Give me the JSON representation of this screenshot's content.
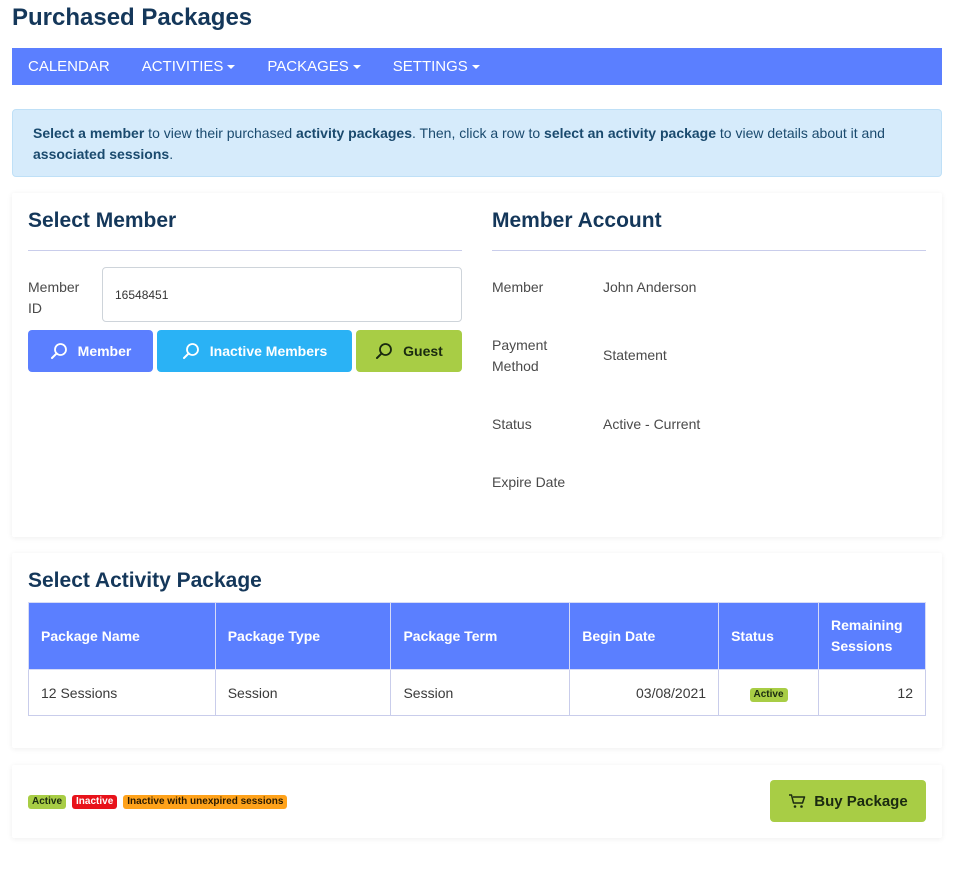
{
  "page": {
    "title": "Purchased Packages"
  },
  "nav": {
    "items": [
      {
        "label": "CALENDAR",
        "dropdown": false
      },
      {
        "label": "ACTIVITIES",
        "dropdown": true
      },
      {
        "label": "PACKAGES",
        "dropdown": true
      },
      {
        "label": "SETTINGS",
        "dropdown": true
      }
    ]
  },
  "alert": {
    "p1": "Select a member",
    "p2": " to view their purchased ",
    "p3": "activity packages",
    "p4": ". Then, click a row to ",
    "p5": "select an activity package",
    "p6": " to view details about it and ",
    "p7": "associated sessions",
    "p8": "."
  },
  "select_member": {
    "title": "Select Member",
    "member_id_label": "Member ID",
    "member_id_value": "16548451",
    "buttons": {
      "member": "Member",
      "inactive": "Inactive Members",
      "guest": "Guest"
    }
  },
  "account": {
    "title": "Member Account",
    "member_label": "Member",
    "member_value": "John Anderson",
    "payment_label": "Payment Method",
    "payment_value": "Statement",
    "status_label": "Status",
    "status_value": "Active - Current",
    "expire_label": "Expire Date",
    "expire_value": ""
  },
  "packages": {
    "title": "Select Activity Package",
    "columns": [
      "Package Name",
      "Package Type",
      "Package Term",
      "Begin Date",
      "Status",
      "Remaining Sessions"
    ],
    "rows": [
      {
        "name": "12 Sessions",
        "type": "Session",
        "term": "Session",
        "begin": "03/08/2021",
        "status": "Active",
        "remaining": "12"
      }
    ]
  },
  "legend": {
    "active": "Active",
    "inactive": "Inactive",
    "unexpired": "Inactive with unexpired sessions"
  },
  "buy_button": "Buy Package",
  "colors": {
    "primary": "#5b7fff",
    "info": "#2ab2f5",
    "success": "#a8cd45",
    "danger": "#e8121a",
    "warning": "#ffa21a",
    "heading": "#14375a"
  }
}
